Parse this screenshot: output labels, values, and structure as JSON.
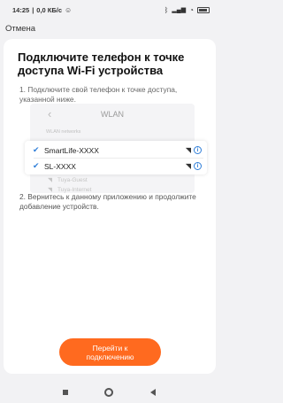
{
  "status_bar": {
    "time": "14:25",
    "speed": "0,0 КБ/с"
  },
  "header": {
    "cancel_label": "Отмена"
  },
  "main": {
    "title": "Подключите телефон к точке доступа Wi-Fi устройства",
    "step1": "1. Подключите свой телефон к точке доступа, указанной ниже.",
    "wlan_title": "WLAN",
    "wlan_section_label": "WLAN networks",
    "networks": [
      {
        "name": "SmartLife-XXXX"
      },
      {
        "name": "SL-XXXX"
      }
    ],
    "other_networks": [
      {
        "name": "Tuya-Guest"
      },
      {
        "name": "Tuya-Internet"
      }
    ],
    "step2": "2. Вернитесь к данному приложению и продолжите добавление устройств.",
    "go_button": "Перейти к подключению"
  },
  "colors": {
    "accent": "#ff6a1f",
    "check": "#2f7ed8"
  }
}
